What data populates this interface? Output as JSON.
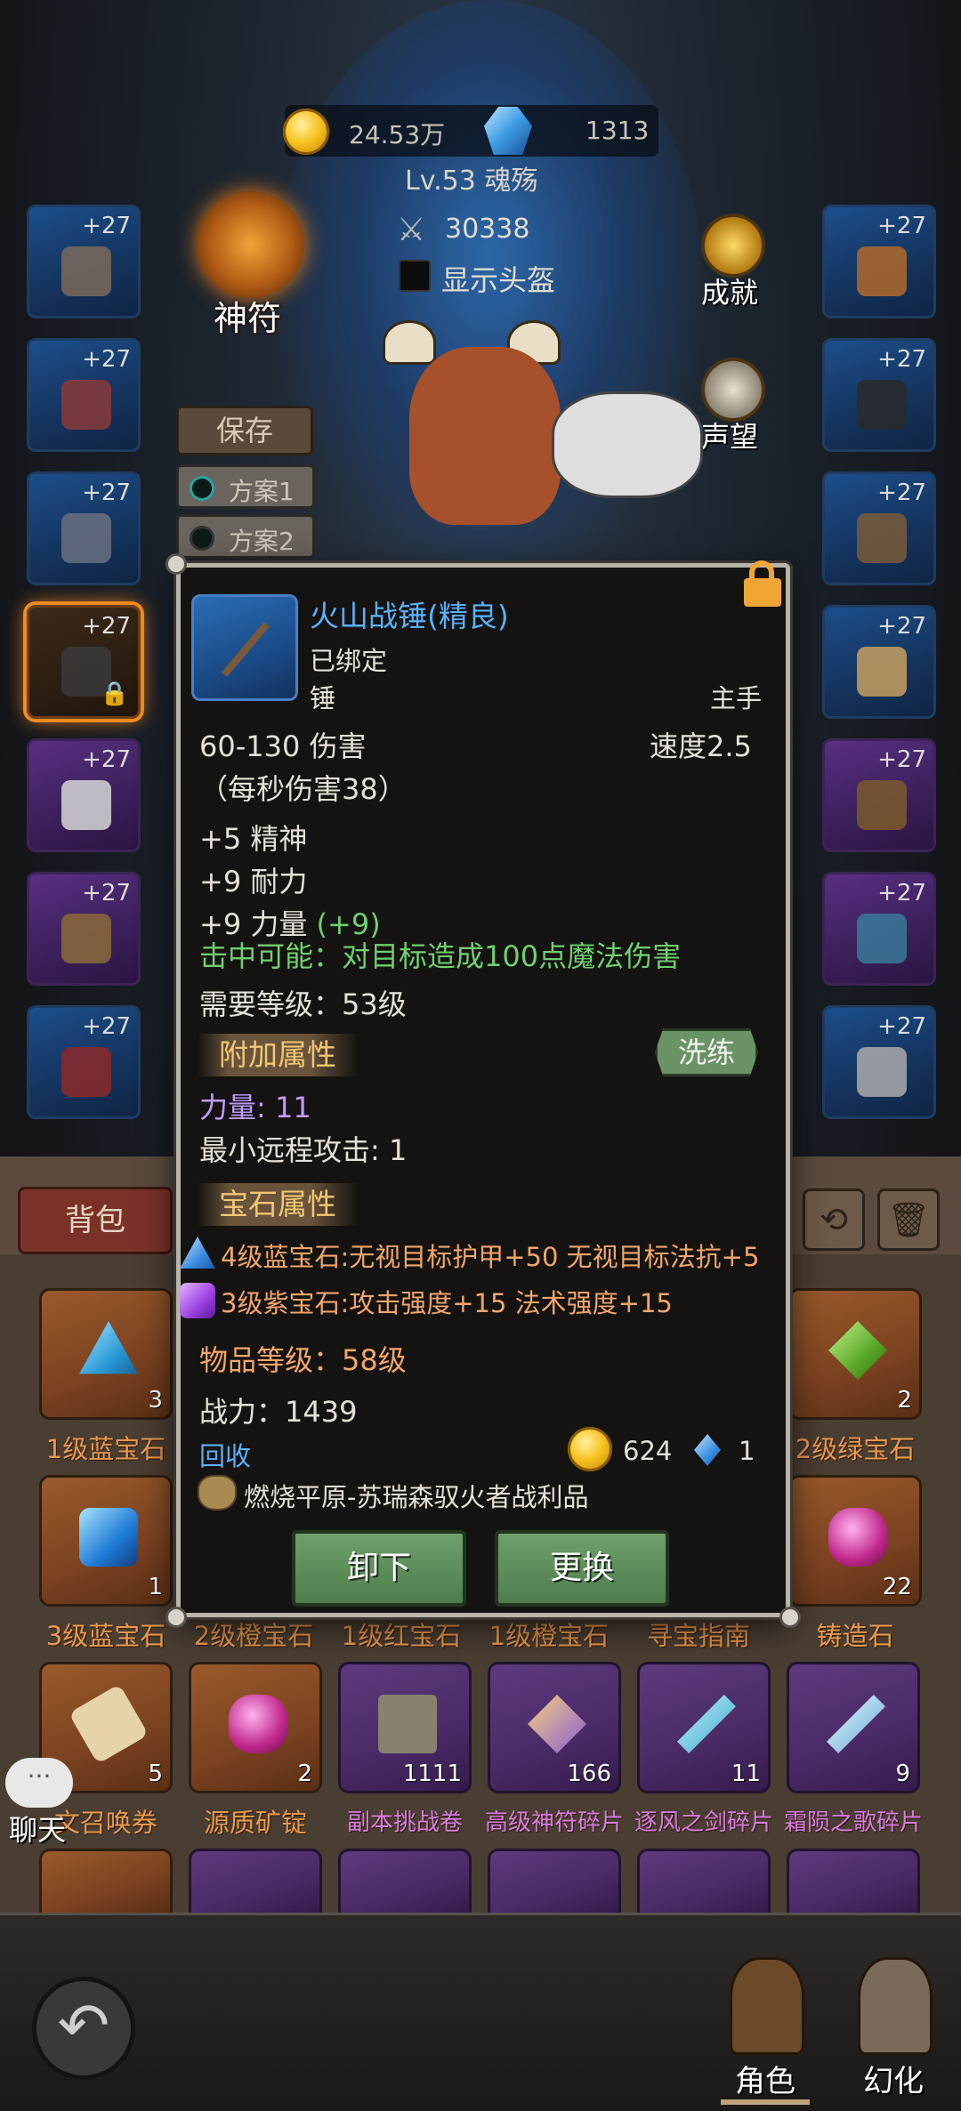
{
  "header": {
    "gold": "24.53万",
    "diamonds": "1313",
    "level": "Lv.53 魂殇",
    "combat_power": "30338",
    "show_helmet": "显示头盔"
  },
  "left_controls": {
    "rune": "神符",
    "save": "保存",
    "plans": [
      "方案1",
      "方案2"
    ]
  },
  "right_controls": {
    "achievements": "成就",
    "reputation": "声望"
  },
  "equipment_slots": {
    "left": [
      "+27",
      "+27",
      "+27",
      "+27",
      "+27",
      "+27",
      "+27"
    ],
    "right": [
      "+27",
      "+27",
      "+27",
      "+27",
      "+27",
      "+27",
      "+27"
    ]
  },
  "tooltip": {
    "name": "火山战锤(精良)",
    "bound": "已绑定",
    "type": "锤",
    "slot": "主手",
    "damage": "60-130 伤害",
    "speed": "速度2.5",
    "dps": "（每秒伤害38）",
    "stats": [
      "+5 精神",
      "+9 耐力"
    ],
    "strength": "+9 力量",
    "strength_bonus": "(+9)",
    "on_hit": "击中可能：对目标造成100点魔法伤害",
    "required_level": "需要等级：53级",
    "extra_header": "附加属性",
    "refine": "洗练",
    "extra_strength": "力量: 11",
    "extra_ranged": "最小远程攻击: 1",
    "gem_header": "宝石属性",
    "gem1": "4级蓝宝石:无视目标护甲+50 无视目标法抗+5",
    "gem2": "3级紫宝石:攻击强度+15 法术强度+15",
    "item_level": "物品等级：58级",
    "power": "战力：1439",
    "recycle": "回收",
    "recycle_gold": "624",
    "recycle_gems": "1",
    "source": "燃烧平原-苏瑞森驭火者战利品",
    "unequip": "卸下",
    "replace": "更换"
  },
  "inventory": {
    "tab": "背包",
    "row1": [
      {
        "label": "1级蓝宝石",
        "count": "3"
      },
      {
        "label": "2级绿宝石",
        "count": "2"
      }
    ],
    "row2": [
      {
        "label": "3级蓝宝石",
        "count": "1"
      },
      {
        "label": "2级橙宝石",
        "count": ""
      },
      {
        "label": "1级红宝石",
        "count": ""
      },
      {
        "label": "1级橙宝石",
        "count": ""
      },
      {
        "label": "寻宝指南",
        "count": ""
      },
      {
        "label": "铸造石",
        "count": "22"
      }
    ],
    "row3": [
      {
        "label": "文召唤券",
        "count": "5"
      },
      {
        "label": "源质矿锭",
        "count": "2"
      },
      {
        "label": "副本挑战卷",
        "count": "1111"
      },
      {
        "label": "高级神符碎片",
        "count": "166"
      },
      {
        "label": "逐风之剑碎片",
        "count": "11"
      },
      {
        "label": "霜陨之歌碎片",
        "count": "9"
      }
    ]
  },
  "chat": {
    "bubble": "···",
    "label": "聊天"
  },
  "bottom_nav": {
    "back_icon": "↶",
    "tabs": [
      "角色",
      "幻化"
    ]
  }
}
